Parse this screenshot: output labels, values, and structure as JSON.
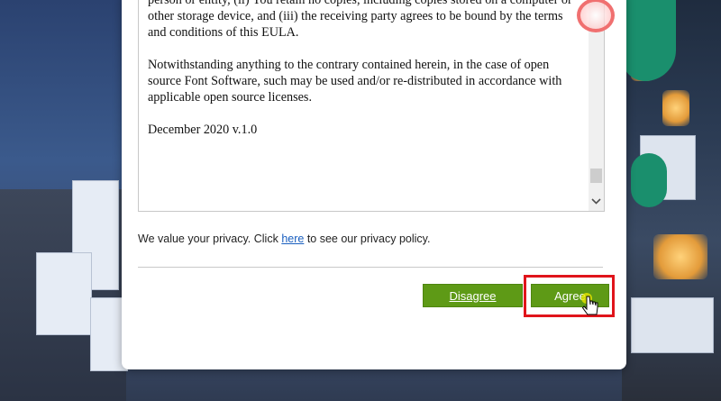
{
  "eula": {
    "paragraphs": [
      "person or entity, (ii) You retain no copies, including copies stored on a computer or other storage device, and (iii) the receiving party agrees to be bound by the terms and conditions of this EULA.",
      "Notwithstanding anything to the contrary contained herein, in the case of open source Font Software, such may be used and/or re-distributed in accordance with applicable open source licenses.",
      "December 2020 v.1.0"
    ]
  },
  "privacy": {
    "prefix": "We value your privacy. Click ",
    "link": "here",
    "suffix": " to see our privacy policy."
  },
  "buttons": {
    "disagree": "Disagree",
    "agree": "Agree"
  },
  "icons": {
    "scroll_down": "chevron-down-icon",
    "cursor": "hand-pointer-icon"
  },
  "colors": {
    "button_green": "#5e9a16",
    "highlight_red": "#e0141b",
    "link_blue": "#1a5fbf"
  }
}
